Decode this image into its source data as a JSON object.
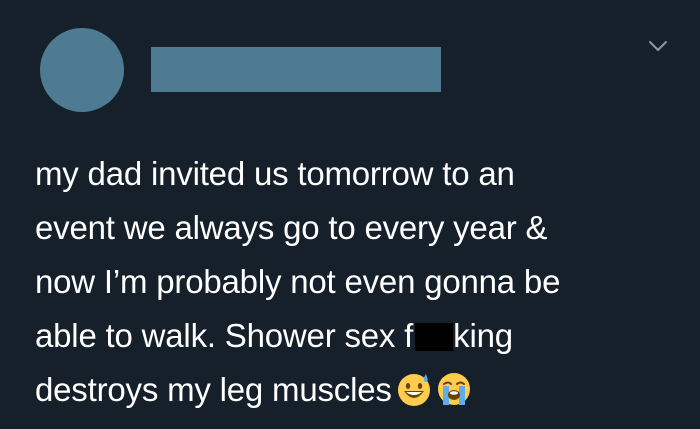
{
  "tweet": {
    "author": {
      "avatar": "avatar-placeholder",
      "name_redacted": true
    },
    "menu_icon": "chevron-down-icon",
    "text_lines": [
      "my dad invited us tomorrow to an",
      "event we always go to every year &",
      "now I’m probably not even gonna be",
      "able to walk. Shower sex f",
      "king",
      "destroys my leg muscles"
    ],
    "emojis": [
      "grinning-sweat-emoji",
      "loudly-crying-emoji"
    ],
    "colors": {
      "background": "#15202b",
      "placeholder": "#4e7b91",
      "text": "#ffffff",
      "chevron": "#8899a6",
      "censor": "#000000"
    }
  }
}
